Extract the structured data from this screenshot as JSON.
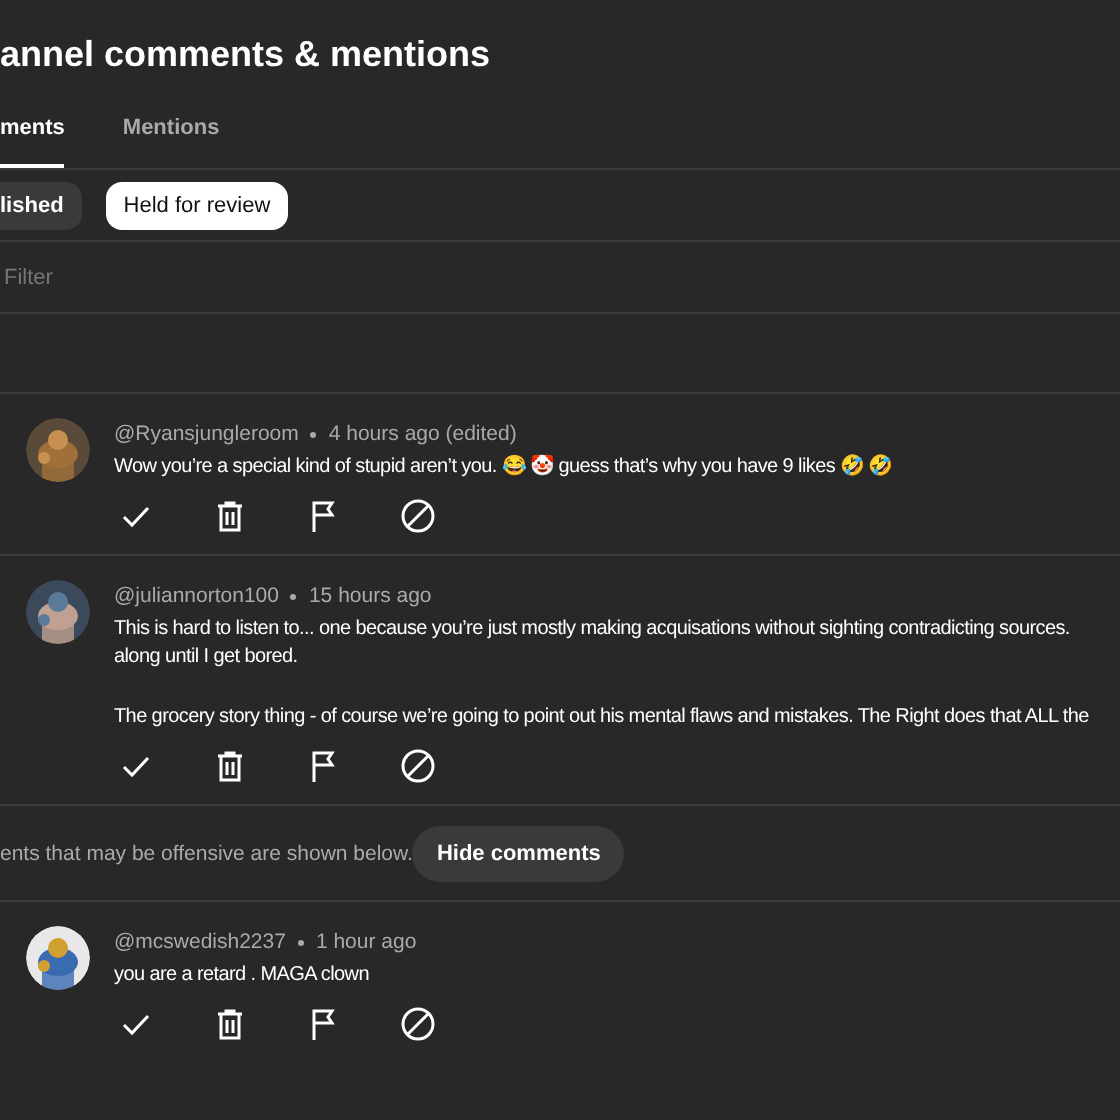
{
  "page": {
    "title": "annel comments & mentions"
  },
  "tabs": [
    {
      "label": "ments",
      "selected": true
    },
    {
      "label": "Mentions",
      "selected": false
    }
  ],
  "chips": [
    {
      "label": "lished",
      "selected": false
    },
    {
      "label": "Held for review",
      "selected": true
    }
  ],
  "filter": {
    "placeholder": "Filter"
  },
  "comments": [
    {
      "author": "@Ryansjungleroom",
      "time": "4 hours ago (edited)",
      "paragraphs": [
        [
          "Wow you’re a special kind of stupid aren’t you. 😂 🤡 guess that’s why you have 9 likes 🤣 🤣"
        ]
      ]
    },
    {
      "author": "@juliannorton100",
      "time": "15 hours ago",
      "paragraphs": [
        [
          "This is hard to listen to... one because you’re just mostly making acquisations without sighting contradicting sources.",
          "along until I get bored."
        ],
        [
          "The grocery story thing - of course we’re going to point out his mental flaws and mistakes. The Right does that ALL the"
        ]
      ]
    }
  ],
  "notice": {
    "text": "ents that may be offensive are shown below.",
    "button": "Hide comments"
  },
  "flagged_comments": [
    {
      "author": "@mcswedish2237",
      "time": "1 hour ago",
      "paragraphs": [
        [
          "you are a retard . MAGA clown"
        ]
      ]
    }
  ]
}
